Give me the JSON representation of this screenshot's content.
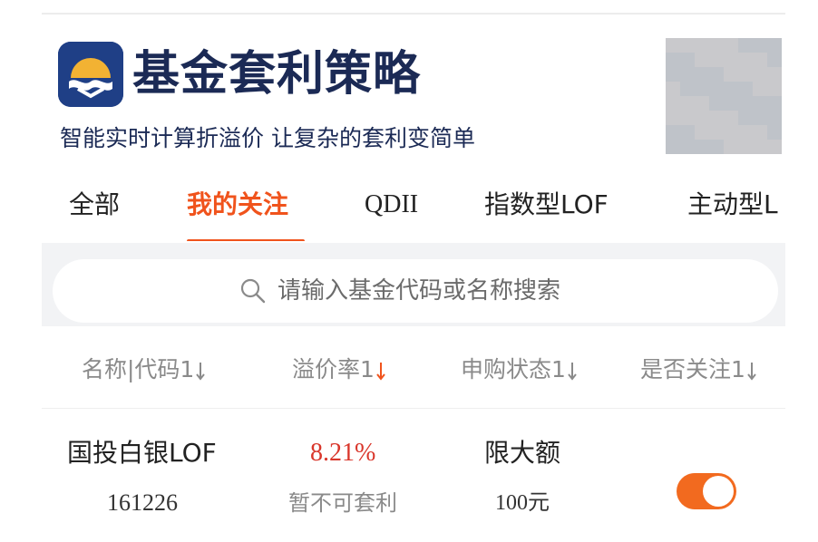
{
  "header": {
    "app_title": "基金套利策略",
    "slogan": "智能实时计算折溢价 让复杂的套利变简单"
  },
  "tabs": [
    {
      "label": "全部"
    },
    {
      "label": "我的关注",
      "active": true
    },
    {
      "label": "QDII"
    },
    {
      "label": "指数型LOF"
    },
    {
      "label": "主动型L"
    }
  ],
  "search": {
    "placeholder": "请输入基金代码或名称搜索"
  },
  "columns": [
    {
      "label": "名称|代码1"
    },
    {
      "label": "溢价率1"
    },
    {
      "label": "申购状态1"
    },
    {
      "label": "是否关注1"
    }
  ],
  "funds": [
    {
      "name": "国投白银LOF",
      "code": "161226",
      "premium_rate": "8.21%",
      "arbitrage_status": "暂不可套利",
      "purchase_status": "限大额",
      "purchase_limit": "100元",
      "followed": true
    }
  ],
  "colors": {
    "accent": "#f0531c",
    "title_navy": "#1b2a55",
    "logo_blue": "#1f3f86",
    "toggle_on": "#f26a1f",
    "premium_red": "#d9362b"
  },
  "icons": [
    "app-logo-icon",
    "search-icon",
    "sort-icon",
    "avatar-pixelated"
  ]
}
